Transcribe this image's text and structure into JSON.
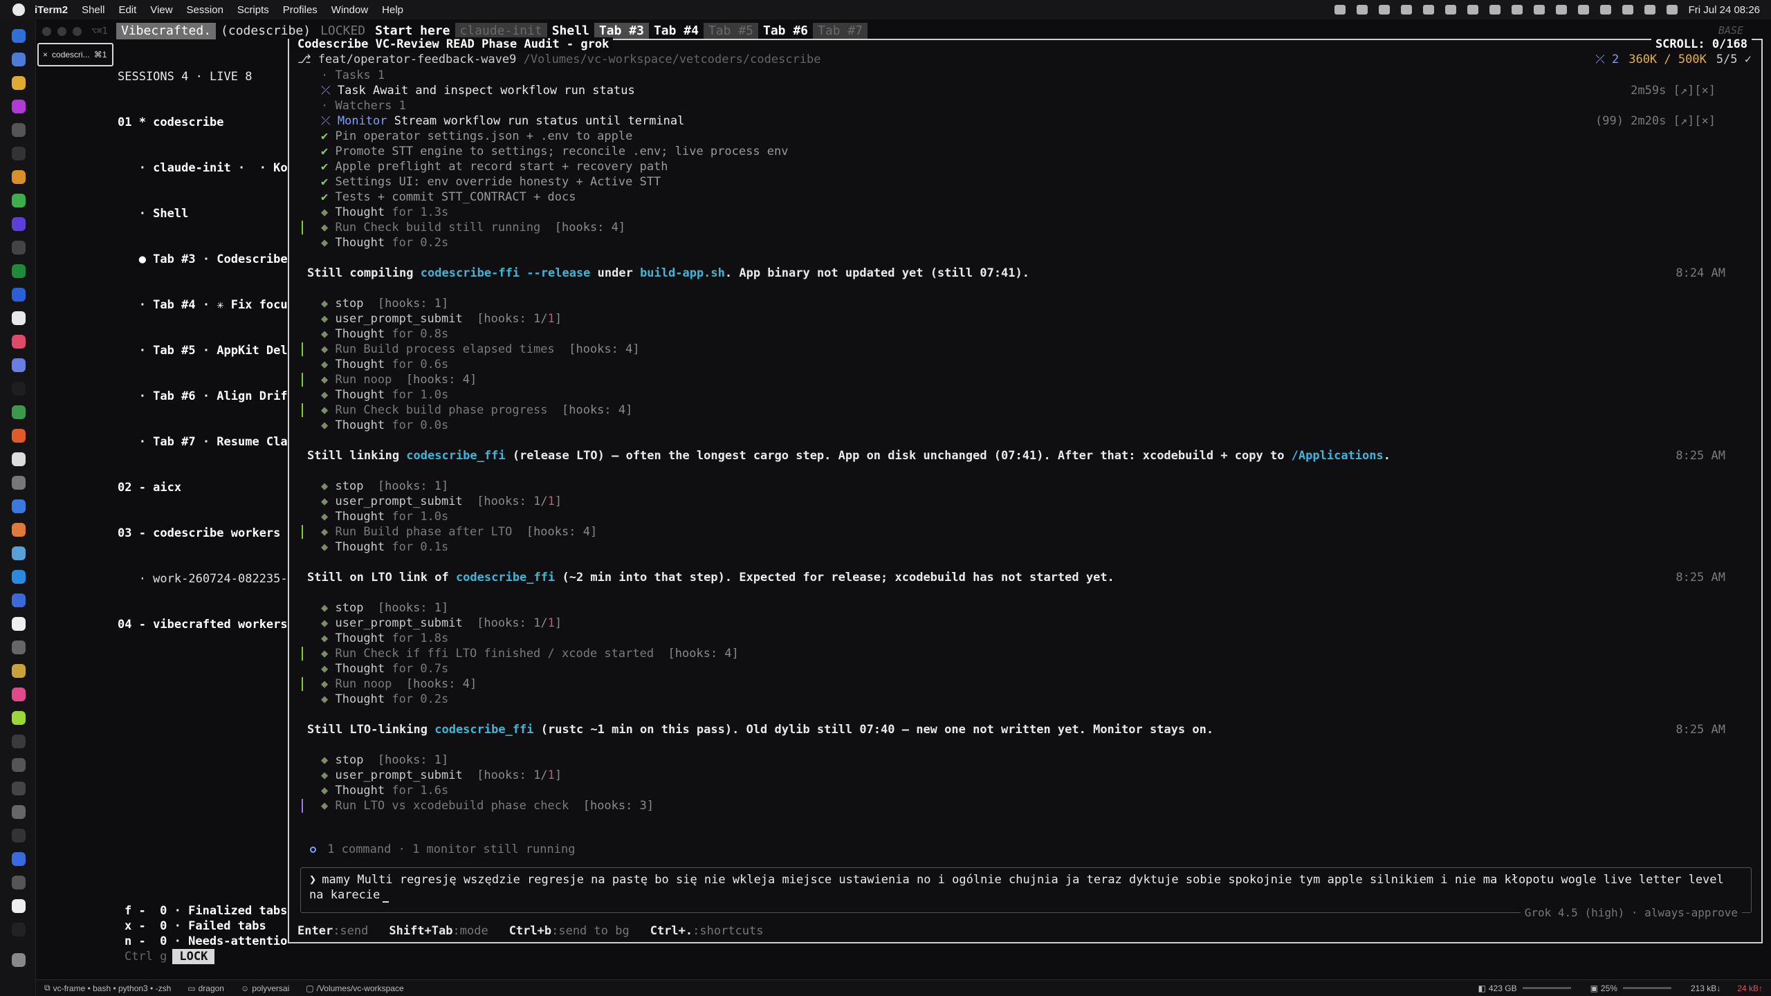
{
  "menubar": {
    "app_name": "iTerm2",
    "items": [
      "Shell",
      "Edit",
      "View",
      "Session",
      "Scripts",
      "Profiles",
      "Window",
      "Help"
    ],
    "clock": "Fri Jul 24  08:26"
  },
  "titlebar": {
    "kbd_hint": "⌥⌘1"
  },
  "tabline": {
    "brand": "Vibecrafted.",
    "brand_sub": "(codescribe)",
    "locked": "LOCKED",
    "start_here": "Start here",
    "claude_init": "claude-init",
    "shell": "Shell",
    "tab3": "Tab #3",
    "tab4": "Tab #4",
    "tab5": "Tab #5",
    "tab6": "Tab #6",
    "tab7": "Tab #7",
    "base": "BASE"
  },
  "thumb": {
    "label": "codescri...",
    "shortcut": "⌘1"
  },
  "sessions": {
    "header": "SESSIONS 4 · LIVE 8",
    "rows": [
      {
        "text": "01 * codescribe",
        "style": "b"
      },
      {
        "text": "   · claude-init ·  · Kon",
        "style": "b"
      },
      {
        "text": "   · Shell",
        "style": "b"
      },
      {
        "text": "   ● Tab #3 · Codescribe",
        "style": "b"
      },
      {
        "text": "   · Tab #4 · ✳ Fix focu",
        "style": "b"
      },
      {
        "text": "   · Tab #5 · AppKit Del",
        "style": "b"
      },
      {
        "text": "   · Tab #6 · Align Drif",
        "style": "b"
      },
      {
        "text": "   · Tab #7 · Resume Cla",
        "style": "b"
      },
      {
        "text": "02 - aicx",
        "style": "b"
      },
      {
        "text": "03 - codescribe workers",
        "style": "b"
      },
      {
        "text": "   · work-260724-082235-",
        "style": "n"
      },
      {
        "text": "04 - vibecrafted workers",
        "style": "b"
      }
    ],
    "footer": [
      "f -  0 · Finalized tabs",
      "x -  0 · Failed tabs",
      "n -  0 · Needs-attentio"
    ],
    "ctrl_hint": "Ctrl g",
    "lock_label": "LOCK"
  },
  "pane": {
    "title": "Codescribe VC-Review READ Phase Audit - grok",
    "scroll": "SCROLL:  0/168",
    "branch": "⎇ feat/operator-feedback-wave9",
    "path": "/Volumes/vc-workspace/vetcoders/codescribe",
    "jobs": "⤫ 2",
    "tokens": "360K / 500K",
    "steps": "5/5 ✓"
  },
  "log": {
    "tasks_header": "Tasks 1",
    "task_line": "Task Await and inspect workflow run status",
    "task_right": "2m59s [↗][×]",
    "watchers_header": "Watchers 1",
    "monitor_label": "Monitor",
    "monitor_text": " Stream workflow run status until terminal",
    "monitor_right": "(99) 2m20s [↗][×]",
    "done_items": [
      "Pin operator settings.json + .env to apple",
      "Promote STT engine to settings; reconcile .env; live process env",
      "Apple preflight at record start + recovery path",
      "Settings UI: env override honesty + Active STT",
      "Tests + commit STT_CONTRACT + docs"
    ],
    "blocks": [
      {
        "pre": [
          {
            "kind": "thought",
            "text": "Thought",
            "rest": " for 1.3s"
          },
          {
            "kind": "run",
            "text": "Run Check build still running",
            "hooks": "4",
            "bar": "green"
          },
          {
            "kind": "thought",
            "text": "Thought",
            "rest": " for 0.2s"
          }
        ],
        "msg": [
          {
            "t": "Still compiling ",
            "c": "white"
          },
          {
            "t": "codescribe-ffi --release",
            "c": "accent"
          },
          {
            "t": " under ",
            "c": "white"
          },
          {
            "t": "build-app.sh",
            "c": "accent"
          },
          {
            "t": ". App binary not updated yet (still 07:41).",
            "c": "white"
          }
        ],
        "time": "8:24 AM"
      },
      {
        "pre": [
          {
            "kind": "stop",
            "text": "stop",
            "hooks_frac": "1"
          },
          {
            "kind": "ups",
            "text": "user_prompt_submit"
          },
          {
            "kind": "thought",
            "text": "Thought",
            "rest": " for 0.8s"
          },
          {
            "kind": "run",
            "text": "Run Build process elapsed times",
            "hooks": "4",
            "bar": "green"
          },
          {
            "kind": "thought",
            "text": "Thought",
            "rest": " for 0.6s"
          },
          {
            "kind": "run",
            "text": "Run noop",
            "hooks": "4",
            "bar": "green"
          },
          {
            "kind": "thought",
            "text": "Thought",
            "rest": " for 1.0s"
          },
          {
            "kind": "run",
            "text": "Run Check build phase progress",
            "hooks": "4",
            "bar": "green"
          },
          {
            "kind": "thought",
            "text": "Thought",
            "rest": " for 0.0s"
          }
        ],
        "msg": [
          {
            "t": "Still linking ",
            "c": "white"
          },
          {
            "t": "codescribe_ffi",
            "c": "accent"
          },
          {
            "t": " (release LTO) — often the longest cargo step. App on disk unchanged (07:41). After that: xcodebuild + copy to ",
            "c": "white"
          },
          {
            "t": "/Applications",
            "c": "accent"
          },
          {
            "t": ".",
            "c": "white"
          }
        ],
        "time": "8:25 AM"
      },
      {
        "pre": [
          {
            "kind": "stop",
            "text": "stop"
          },
          {
            "kind": "ups",
            "text": "user_prompt_submit"
          },
          {
            "kind": "thought",
            "text": "Thought",
            "rest": " for 1.0s"
          },
          {
            "kind": "run",
            "text": "Run Build phase after LTO",
            "hooks": "4",
            "bar": "green"
          },
          {
            "kind": "thought",
            "text": "Thought",
            "rest": " for 0.1s"
          }
        ],
        "msg": [
          {
            "t": "Still on LTO link of ",
            "c": "white"
          },
          {
            "t": "codescribe_ffi",
            "c": "accent"
          },
          {
            "t": " (~2 min into that step). Expected for release; xcodebuild has not started yet.",
            "c": "white"
          }
        ],
        "time": "8:25 AM"
      },
      {
        "pre": [
          {
            "kind": "stop",
            "text": "stop"
          },
          {
            "kind": "ups",
            "text": "user_prompt_submit"
          },
          {
            "kind": "thought",
            "text": "Thought",
            "rest": " for 1.8s"
          },
          {
            "kind": "run",
            "text": "Run Check if ffi LTO finished / xcode started",
            "hooks": "4",
            "bar": "green"
          },
          {
            "kind": "thought",
            "text": "Thought",
            "rest": " for 0.7s"
          },
          {
            "kind": "run",
            "text": "Run noop",
            "hooks": "4",
            "bar": "green"
          },
          {
            "kind": "thought",
            "text": "Thought",
            "rest": " for 0.2s"
          }
        ],
        "msg": [
          {
            "t": "Still LTO-linking ",
            "c": "white"
          },
          {
            "t": "codescribe_ffi",
            "c": "accent"
          },
          {
            "t": " (rustc ~1 min on this pass). Old dylib still 07:40 — new one not written yet. Monitor stays on.",
            "c": "white"
          }
        ],
        "time": "8:25 AM"
      },
      {
        "pre": [
          {
            "kind": "stop",
            "text": "stop"
          },
          {
            "kind": "ups",
            "text": "user_prompt_submit"
          },
          {
            "kind": "thought",
            "text": "Thought",
            "rest": " for 1.6s"
          },
          {
            "kind": "run",
            "text": "Run LTO vs xcodebuild phase check",
            "hooks": "3",
            "bar": "purple"
          }
        ],
        "msg": null,
        "time": null
      }
    ],
    "hooks_prefix": "[hooks: ",
    "hooks_suffix": "]",
    "ups_hooks": "1/1",
    "stop_hooks": "1"
  },
  "status_line": "1 command · 1 monitor still running",
  "input": {
    "prompt": "❯",
    "text": "mamy Multi regresję wszędzie regresje na pastę bo się nie wkleja miejsce ustawienia no i ogólnie chujnia ja teraz dyktuje sobie spokojnie tym apple silnikiem i nie ma kłopotu wogle live letter level na karecie"
  },
  "model_label": "Grok 4.5 (high) · always-approve",
  "shortcuts": [
    {
      "key": "Enter",
      "desc": ":send"
    },
    {
      "key": "Shift+Tab",
      "desc": ":mode"
    },
    {
      "key": "Ctrl+b",
      "desc": ":send to bg"
    },
    {
      "key": "Ctrl+.",
      "desc": ":shortcuts"
    }
  ],
  "bottombar": {
    "session": "vc-frame • bash • python3 • -zsh",
    "host": "dragon",
    "user": "polyversai",
    "cwd": "/Volumes/vc-workspace",
    "disk": "423 GB",
    "cpu": "25%",
    "net_up": "213 kB↓",
    "net_down": "24 kB↑"
  },
  "colors": {
    "accent": "#3fb6d8",
    "done": "#8fcf4f",
    "run_bar": "#7ccf3a",
    "hooks_num": "#c7586f"
  }
}
